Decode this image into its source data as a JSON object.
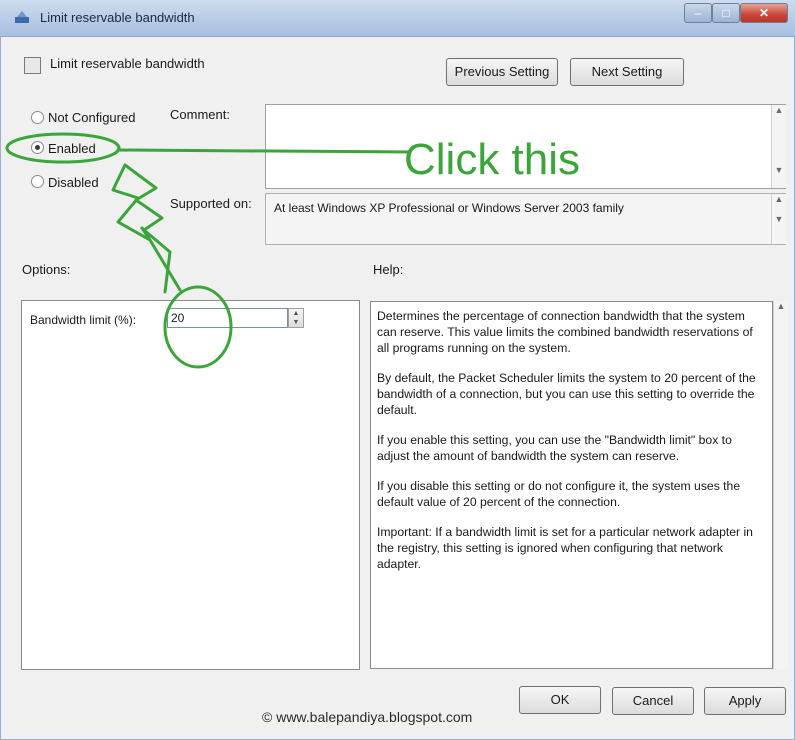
{
  "window": {
    "title": "Limit reservable bandwidth",
    "caption_buttons": {
      "minimize": "–",
      "maximize": "□",
      "close": "✕"
    }
  },
  "policy": {
    "name": "Limit reservable bandwidth"
  },
  "nav": {
    "previous_label": "Previous Setting",
    "next_label": "Next Setting"
  },
  "state": {
    "options": [
      {
        "label": "Not Configured",
        "selected": false
      },
      {
        "label": "Enabled",
        "selected": true
      },
      {
        "label": "Disabled",
        "selected": false
      }
    ]
  },
  "comment": {
    "label": "Comment:",
    "value": ""
  },
  "supported": {
    "label": "Supported on:",
    "value": "At least Windows XP Professional or Windows Server 2003 family"
  },
  "options_section": {
    "label": "Options:",
    "bandwidth_label": "Bandwidth limit (%):",
    "bandwidth_value": "20"
  },
  "help_section": {
    "label": "Help:",
    "paragraphs": [
      "Determines the percentage of connection bandwidth that the system can reserve. This value limits the combined bandwidth reservations of all programs running on the system.",
      "By default, the Packet Scheduler limits the system to 20 percent of the bandwidth of a connection, but you can use this setting to override the default.",
      "If you enable this setting, you can use the \"Bandwidth limit\" box to adjust the amount of bandwidth the system can reserve.",
      "If you disable this setting or do not configure it, the system uses the default value of 20 percent of the connection.",
      "Important: If a bandwidth limit is set for a particular network adapter in the registry, this setting is ignored when configuring that network adapter."
    ]
  },
  "dialog_buttons": {
    "ok": "OK",
    "cancel": "Cancel",
    "apply": "Apply"
  },
  "annotation": {
    "text": "Click this",
    "color": "#3aa53a"
  },
  "watermark": "© www.balepandiya.blogspot.com"
}
